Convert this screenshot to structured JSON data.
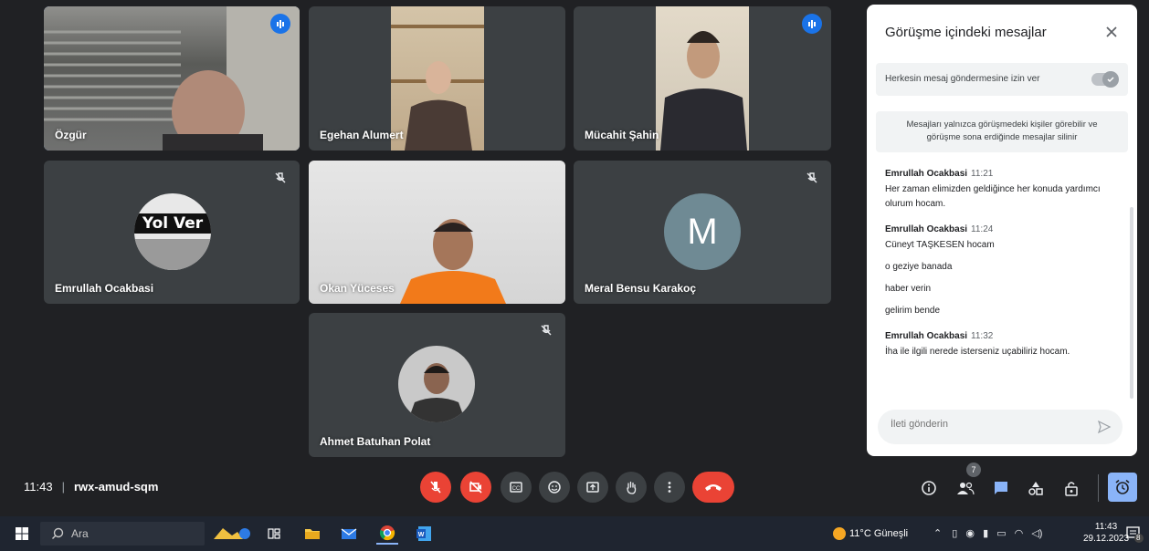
{
  "participants": [
    {
      "name": "Özgür",
      "state": "speaking"
    },
    {
      "name": "Egehan Alumert",
      "state": "video"
    },
    {
      "name": "Mücahit Şahin",
      "state": "speaking"
    },
    {
      "name": "Emrullah Ocakbasi",
      "state": "muted",
      "avatar_text": "Yol Ver"
    },
    {
      "name": "Okan Yüceses",
      "state": "video"
    },
    {
      "name": "Meral Bensu Karakoç",
      "state": "muted",
      "avatar_letter": "M"
    },
    {
      "name": "Ahmet Batuhan Polat",
      "state": "muted"
    }
  ],
  "chat": {
    "title": "Görüşme içindeki mesajlar",
    "toggle_label": "Herkesin mesaj göndermesine izin ver",
    "notice": "Mesajları yalnızca görüşmedeki kişiler görebilir ve görüşme sona erdiğinde mesajlar silinir",
    "messages": [
      {
        "sender": "Emrullah Ocakbasi",
        "time": "11:21",
        "lines": [
          "Her zaman elimizden geldiğince her konuda yardımcı olurum hocam."
        ]
      },
      {
        "sender": "Emrullah Ocakbasi",
        "time": "11:24",
        "lines": [
          "Cüneyt TAŞKESEN hocam",
          "o geziye banada",
          "haber verin",
          "gelirim bende"
        ]
      },
      {
        "sender": "Emrullah Ocakbasi",
        "time": "11:32",
        "lines": [
          "İha ile ilgili nerede isterseniz uçabiliriz hocam."
        ]
      }
    ],
    "input_placeholder": "İleti gönderin"
  },
  "meeting": {
    "time": "11:43",
    "code": "rwx-amud-sqm",
    "participant_count": "7"
  },
  "taskbar": {
    "search_label": "Ara",
    "weather": "11°C Güneşli",
    "clock_time": "11:43",
    "clock_date": "29.12.2023",
    "notification_count": "8"
  },
  "colors": {
    "accent": "#8ab4f8",
    "end_call": "#ea4335",
    "tile_bg": "#3c4043",
    "meet_bg": "#202124"
  }
}
